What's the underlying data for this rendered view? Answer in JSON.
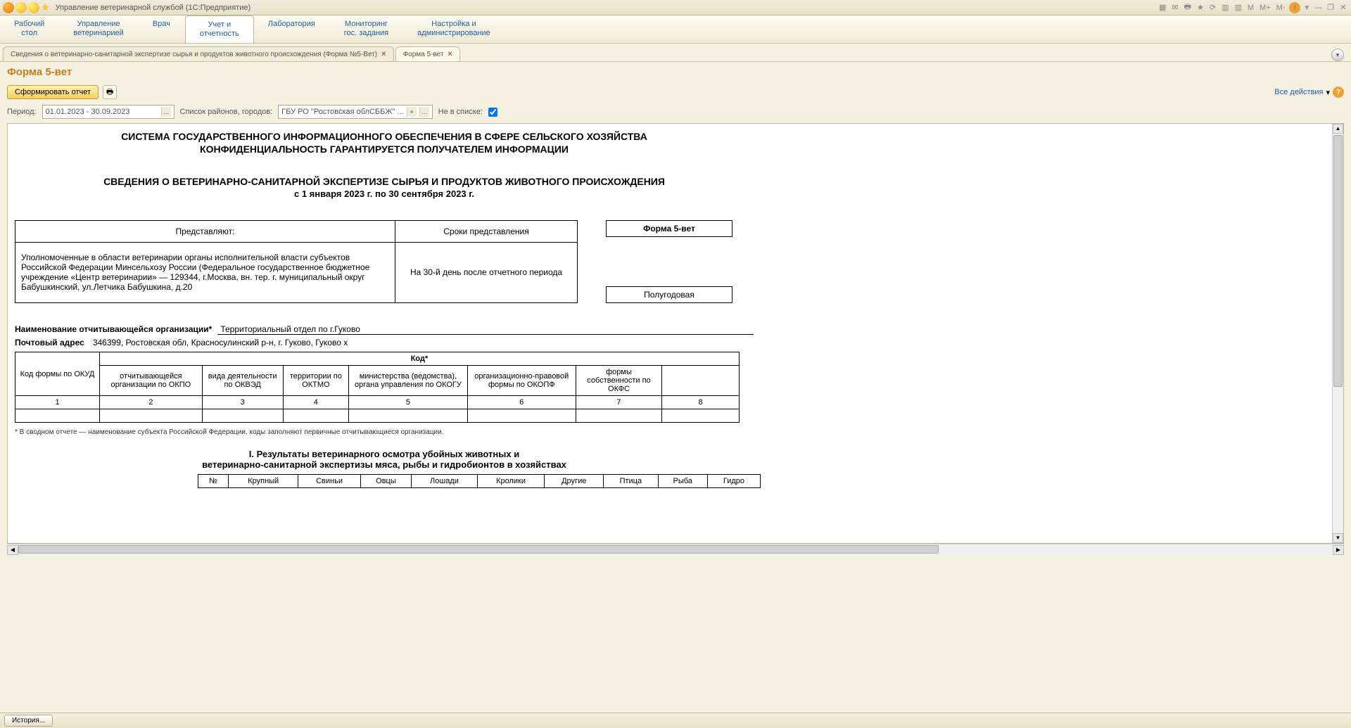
{
  "window": {
    "title": "Управление ветеринарной службой  (1С:Предприятие)"
  },
  "mainmenu": {
    "items": [
      {
        "line1": "Рабочий",
        "line2": "стол"
      },
      {
        "line1": "Управление",
        "line2": "ветеринарией"
      },
      {
        "line1": "Врач",
        "line2": ""
      },
      {
        "line1": "Учет и",
        "line2": "отчетность"
      },
      {
        "line1": "Лаборатория",
        "line2": ""
      },
      {
        "line1": "Мониторинг",
        "line2": "гос. задания"
      },
      {
        "line1": "Настройка и",
        "line2": "администрирование"
      }
    ],
    "active_index": 3
  },
  "tabs": {
    "items": [
      {
        "label": "Сведения о ветеринарно-санитарной экспертизе сырья и продуктов животного происхождения (Форма №5-Вет)"
      },
      {
        "label": "Форма 5-вет"
      }
    ],
    "active_index": 1
  },
  "page": {
    "title": "Форма 5-вет"
  },
  "toolbar": {
    "generate_label": "Сформировать отчет",
    "all_actions": "Все действия"
  },
  "params": {
    "period_label": "Период:",
    "period_value": "01.01.2023 - 30.09.2023",
    "district_label": "Список районов, городов:",
    "district_value": "ГБУ РО \"Ростовская облСББЖ\" ...",
    "not_in_list_label": "Не в списке:",
    "not_in_list_checked": true
  },
  "report": {
    "header1": "СИСТЕМА ГОСУДАРСТВЕННОГО ИНФОРМАЦИОННОГО ОБЕСПЕЧЕНИЯ В СФЕРЕ СЕЛЬСКОГО ХОЗЯЙСТВА",
    "header2": "КОНФИДЕНЦИАЛЬНОСТЬ ГАРАНТИРУЕТСЯ ПОЛУЧАТЕЛЕМ ИНФОРМАЦИИ",
    "title": "СВЕДЕНИЯ О ВЕТЕРИНАРНО-САНИТАРНОЙ ЭКСПЕРТИЗЕ СЫРЬЯ И ПРОДУКТОВ ЖИВОТНОГО ПРОИСХОЖДЕНИЯ",
    "period_line": "с 1 января 2023 г. по 30 сентября 2023 г.",
    "submit_table": {
      "col1_header": "Представляют:",
      "col2_header": "Сроки представления",
      "col1_body": "Уполномоченные в области ветеринарии органы исполнительной власти субъектов Российской Федерации Минсельхозу России (Федеральное государственное бюджетное учреждение «Центр ветеринарии» — 129344, г.Москва, вн. тер. г. муниципальный округ Бабушкинский, ул.Летчика Бабушкина, д.20",
      "col2_body": "На 30-й день после отчетного периода"
    },
    "form_box": "Форма 5-вет",
    "period_box": "Полугодовая",
    "org_name_label": "Наименование отчитывающейся организации*",
    "org_name_value": "Территориальный отдел по г.Гуково",
    "address_label": "Почтовый адрес",
    "address_value": "346399, Ростовская обл, Красносулинский р-н, г. Гуково, Гуково х",
    "codes": {
      "row1_col1": "Код формы по ОКУД",
      "row1_col2": "Код*",
      "row2": [
        "отчитывающейся организации по ОКПО",
        "вида деятельности по ОКВЭД",
        "территории по ОКТМО",
        "министерства (ведомства), органа управления по ОКОГУ",
        "организационно-правовой формы по ОКОПФ",
        "формы собственности по ОКФС",
        ""
      ],
      "row3": [
        "1",
        "2",
        "3",
        "4",
        "5",
        "6",
        "7",
        "8"
      ]
    },
    "footnote": "* В сводном отчете — наименование субъекта Российской Федерации, коды заполняют первичные отчитывающиеся организации.",
    "section1_line1": "I. Результаты ветеринарного осмотра убойных животных и",
    "section1_line2": "ветеринарно-санитарной экспертизы мяса, рыбы и гидробионтов в хозяйствах",
    "bottom_cols": [
      "№",
      "Крупный",
      "Свиньи",
      "Овцы",
      "Лошади",
      "Кролики",
      "Другие",
      "Птица",
      "Рыба",
      "Гидро"
    ]
  },
  "statusbar": {
    "history": "История..."
  },
  "titlebar_right": {
    "m": "M",
    "m_plus": "M+",
    "m_minus": "M-"
  }
}
